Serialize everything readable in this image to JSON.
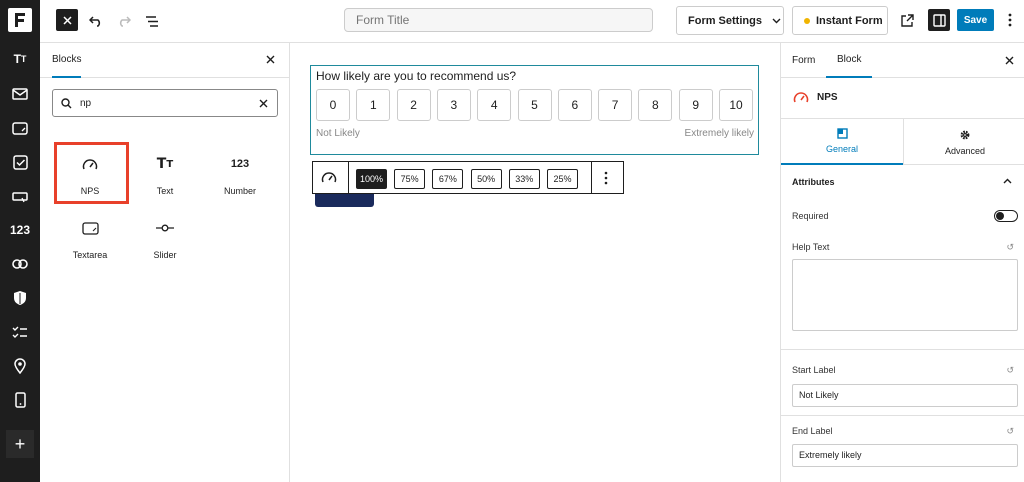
{
  "topbar": {
    "form_title_placeholder": "Form Title",
    "settings_label": "Form Settings",
    "instant_label": "Instant Form",
    "save_label": "Save"
  },
  "rail": {
    "items": [
      "text",
      "mail",
      "textarea",
      "checkbox",
      "button",
      "123",
      "link",
      "shield",
      "checklist",
      "location",
      "mobile"
    ]
  },
  "left_panel": {
    "tab": "Blocks",
    "search_value": "np",
    "blocks": [
      {
        "label": "NPS",
        "icon": "gauge-icon"
      },
      {
        "label": "Text",
        "icon": "text-icon"
      },
      {
        "label": "Number",
        "icon": "number-icon",
        "glyph": "123"
      },
      {
        "label": "Textarea",
        "icon": "textarea-icon"
      },
      {
        "label": "Slider",
        "icon": "slider-icon"
      }
    ]
  },
  "nps": {
    "question": "How likely are you to recommend us?",
    "options": [
      "0",
      "1",
      "2",
      "3",
      "4",
      "5",
      "6",
      "7",
      "8",
      "9",
      "10"
    ],
    "start_label": "Not Likely",
    "end_label": "Extremely likely"
  },
  "toolbar": {
    "widths": [
      "100%",
      "75%",
      "67%",
      "50%",
      "33%",
      "25%"
    ],
    "selected": "100%"
  },
  "right_panel": {
    "tabs": [
      "Form",
      "Block"
    ],
    "active_tab": "Block",
    "block_name": "NPS",
    "subtabs": [
      "General",
      "Advanced"
    ],
    "attributes_heading": "Attributes",
    "required_label": "Required",
    "help_text_label": "Help Text",
    "start_label_label": "Start Label",
    "start_label_value": "Not Likely",
    "end_label_label": "End Label",
    "end_label_value": "Extremely likely"
  },
  "colors": {
    "accent": "#007cba",
    "highlight": "#e8402a",
    "selection": "#1f8a9c",
    "dark": "#1e1e1e"
  }
}
